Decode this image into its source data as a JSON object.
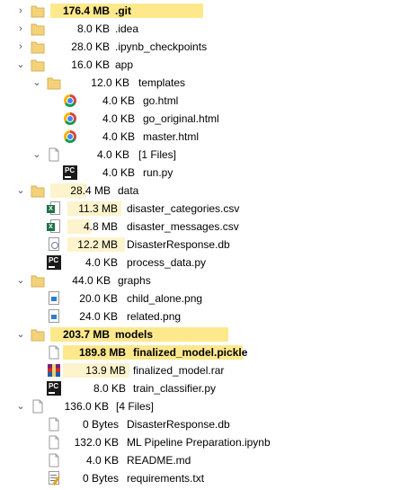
{
  "tree": {
    "rows": [
      {
        "depth": 0,
        "toggle": "collapsed",
        "icon": "folder-icon",
        "size": "176.4 MB",
        "name": ".git",
        "bold": true,
        "bar": "big"
      },
      {
        "depth": 0,
        "toggle": "collapsed",
        "icon": "folder-icon",
        "size": "8.0 KB",
        "name": ".idea"
      },
      {
        "depth": 0,
        "toggle": "collapsed",
        "icon": "folder-icon",
        "size": "28.0 KB",
        "name": ".ipynb_checkpoints"
      },
      {
        "depth": 0,
        "toggle": "expanded",
        "icon": "folder-icon",
        "size": "16.0 KB",
        "name": "app"
      },
      {
        "depth": 1,
        "toggle": "expanded",
        "icon": "folder-icon",
        "size": "12.0 KB",
        "name": "templates"
      },
      {
        "depth": 2,
        "toggle": "none",
        "icon": "chrome-html-icon",
        "size": "4.0 KB",
        "name": "go.html"
      },
      {
        "depth": 2,
        "toggle": "none",
        "icon": "chrome-html-icon",
        "size": "4.0 KB",
        "name": "go_original.html"
      },
      {
        "depth": 2,
        "toggle": "none",
        "icon": "chrome-html-icon",
        "size": "4.0 KB",
        "name": "master.html"
      },
      {
        "depth": 1,
        "toggle": "expanded",
        "icon": "files-group-icon",
        "size": "4.0 KB",
        "name": "[1 Files]"
      },
      {
        "depth": 2,
        "toggle": "none",
        "icon": "pycharm-icon",
        "size": "4.0 KB",
        "name": "run.py"
      },
      {
        "depth": 0,
        "toggle": "expanded",
        "icon": "folder-icon",
        "size": "28.4 MB",
        "name": "data",
        "bar": "light"
      },
      {
        "depth": 1,
        "toggle": "none",
        "icon": "excel-csv-icon",
        "size": "11.3 MB",
        "name": "disaster_categories.csv",
        "bar": "light"
      },
      {
        "depth": 1,
        "toggle": "none",
        "icon": "excel-csv-icon",
        "size": "4.8 MB",
        "name": "disaster_messages.csv",
        "bar": "light"
      },
      {
        "depth": 1,
        "toggle": "none",
        "icon": "database-file-icon",
        "size": "12.2 MB",
        "name": "DisasterResponse.db",
        "bar": "light"
      },
      {
        "depth": 1,
        "toggle": "none",
        "icon": "pycharm-icon",
        "size": "4.0 KB",
        "name": "process_data.py"
      },
      {
        "depth": 0,
        "toggle": "expanded",
        "icon": "folder-icon",
        "size": "44.0 KB",
        "name": "graphs"
      },
      {
        "depth": 1,
        "toggle": "none",
        "icon": "png-image-icon",
        "size": "20.0 KB",
        "name": "child_alone.png"
      },
      {
        "depth": 1,
        "toggle": "none",
        "icon": "png-image-icon",
        "size": "24.0 KB",
        "name": "related.png"
      },
      {
        "depth": 0,
        "toggle": "expanded",
        "icon": "folder-icon",
        "size": "203.7 MB",
        "name": "models",
        "bold": true,
        "bar": "big"
      },
      {
        "depth": 1,
        "toggle": "none",
        "icon": "generic-file-icon",
        "size": "189.8 MB",
        "name": "finalized_model.pickle",
        "bold": true,
        "bar": "big"
      },
      {
        "depth": 1,
        "toggle": "none",
        "icon": "winrar-icon",
        "size": "13.9 MB",
        "name": "finalized_model.rar",
        "bar": "light"
      },
      {
        "depth": 1,
        "toggle": "none",
        "icon": "pycharm-icon",
        "size": "8.0 KB",
        "name": "train_classifier.py"
      },
      {
        "depth": 0,
        "toggle": "expanded",
        "icon": "files-group-icon",
        "size": "136.0 KB",
        "name": "[4 Files]"
      },
      {
        "depth": 1,
        "toggle": "none",
        "icon": "generic-file-icon",
        "size": "0 Bytes",
        "name": "DisasterResponse.db"
      },
      {
        "depth": 1,
        "toggle": "none",
        "icon": "generic-file-icon",
        "size": "132.0 KB",
        "name": "ML Pipeline Preparation.ipynb"
      },
      {
        "depth": 1,
        "toggle": "none",
        "icon": "generic-file-icon",
        "size": "4.0 KB",
        "name": "README.md"
      },
      {
        "depth": 1,
        "toggle": "none",
        "icon": "text-file-icon",
        "size": "0 Bytes",
        "name": "requirements.txt"
      }
    ]
  },
  "colors": {
    "bar_big": "#fde98c",
    "bar_light": "#fdf3cc",
    "folder": "#f3d27a"
  }
}
